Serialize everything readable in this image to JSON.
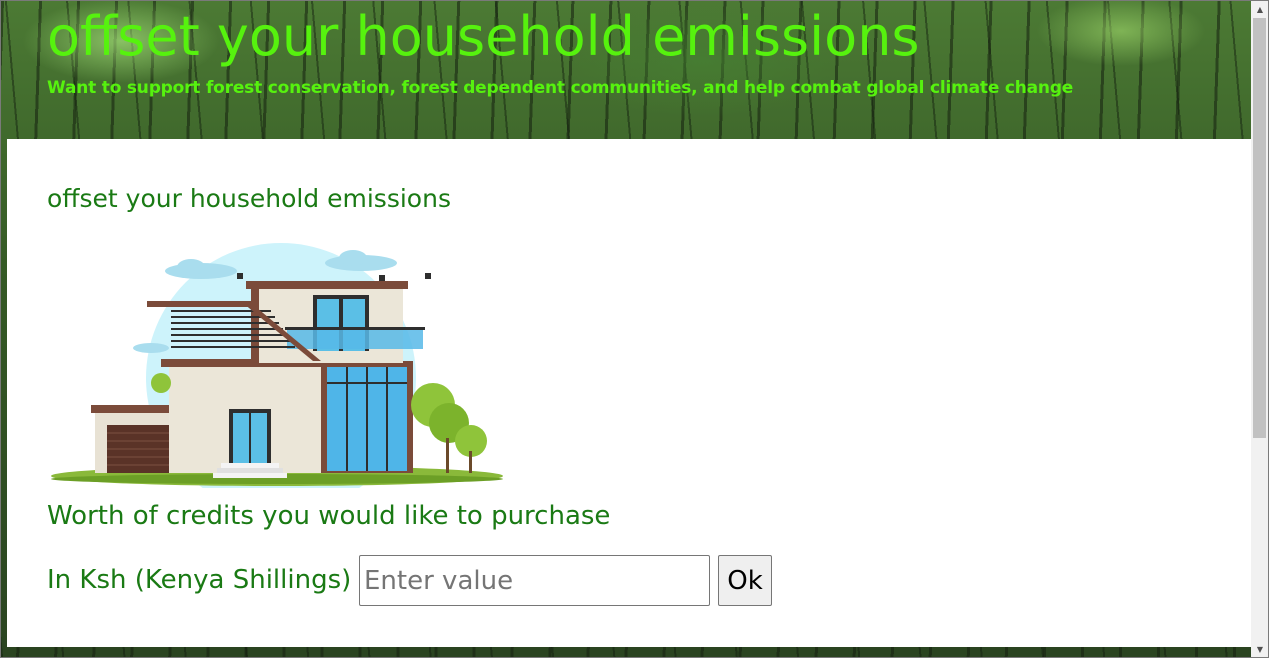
{
  "header": {
    "title": "offset your household emissions",
    "subtitle": "Want to support forest conservation, forest dependent communities, and help combat global climate change"
  },
  "main": {
    "section_title": "offset your household emissions",
    "credits_label": "Worth of credits you would like to purchase",
    "currency_label": "In Ksh (Kenya Shillings)",
    "amount_input": {
      "value": "",
      "placeholder": "Enter value"
    },
    "ok_button": "Ok"
  },
  "icons": {
    "scroll_up": "up-arrow-icon",
    "scroll_down": "down-arrow-icon"
  },
  "colors": {
    "title_green": "#56f20e",
    "text_green": "#1a7a14"
  }
}
